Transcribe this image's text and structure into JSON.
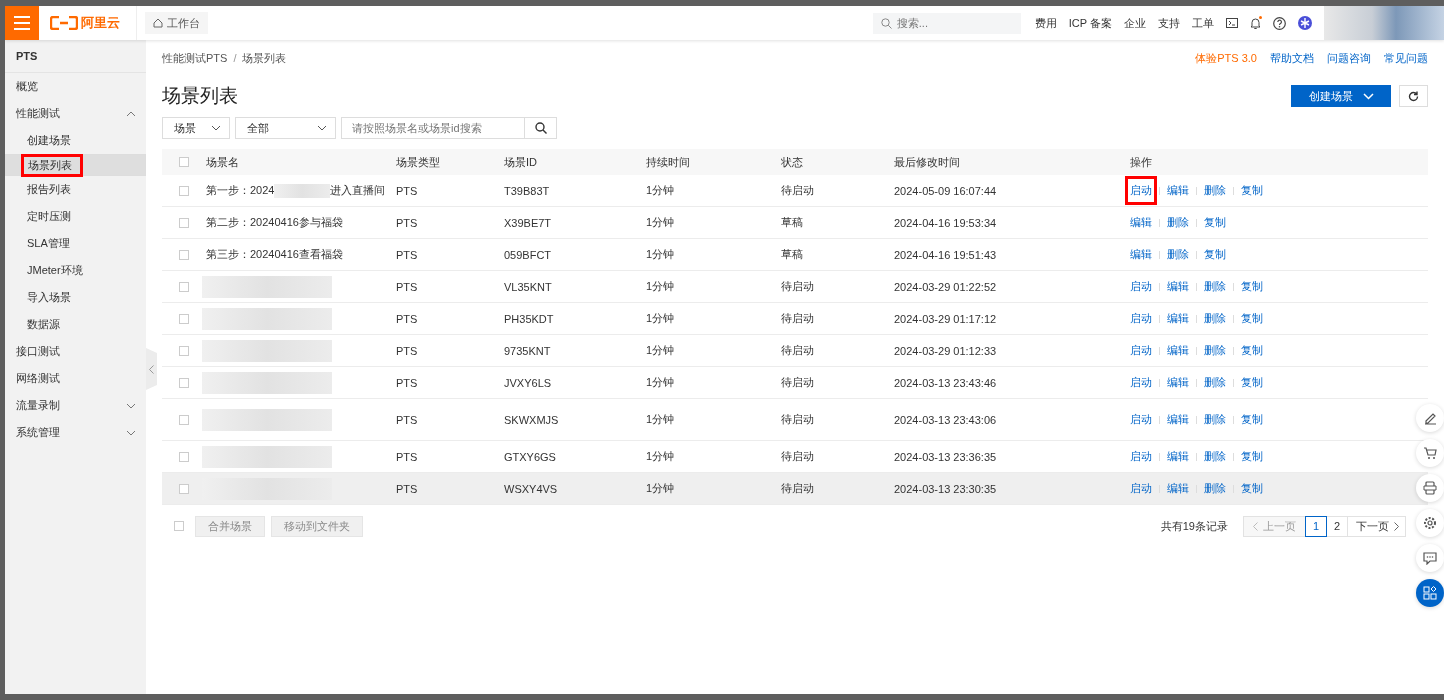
{
  "topbar": {
    "logo": "阿里云",
    "workbench": "工作台",
    "search": {
      "placeholder": "搜索..."
    },
    "links": [
      "费用",
      "ICP 备案",
      "企业",
      "支持",
      "工单"
    ],
    "bell_dot": true
  },
  "sidebar": {
    "title": "PTS",
    "items": [
      {
        "label": "概览",
        "selected": false,
        "highlighted": false
      },
      {
        "label": "性能测试",
        "selected": false,
        "highlighted": false,
        "expanded": true,
        "children": [
          {
            "label": "创建场景",
            "selected": false,
            "highlighted": false
          },
          {
            "label": "场景列表",
            "selected": true,
            "highlighted": true
          },
          {
            "label": "报告列表",
            "selected": false,
            "highlighted": false
          },
          {
            "label": "定时压测",
            "selected": false,
            "highlighted": false
          },
          {
            "label": "SLA管理",
            "selected": false,
            "highlighted": false
          },
          {
            "label": "JMeter环境",
            "selected": false,
            "highlighted": false
          },
          {
            "label": "导入场景",
            "selected": false,
            "highlighted": false
          },
          {
            "label": "数据源",
            "selected": false,
            "highlighted": false
          }
        ]
      },
      {
        "label": "接口测试",
        "selected": false,
        "highlighted": false
      },
      {
        "label": "网络测试",
        "selected": false,
        "highlighted": false
      },
      {
        "label": "流量录制",
        "selected": false,
        "highlighted": false,
        "expanded": false
      },
      {
        "label": "系统管理",
        "selected": false,
        "highlighted": false,
        "expanded": false
      }
    ]
  },
  "breadcrumb": [
    "性能测试PTS",
    "场景列表"
  ],
  "breadcrumb_separator": "/",
  "header_links": [
    {
      "label": "体验PTS 3.0",
      "kind": "promo"
    },
    {
      "label": "帮助文档",
      "kind": "link"
    },
    {
      "label": "问题咨询",
      "kind": "link"
    },
    {
      "label": "常见问题",
      "kind": "link"
    }
  ],
  "page_title": "场景列表",
  "create_button": "创建场景",
  "filters": {
    "type": "场景",
    "status": "全部",
    "search": {
      "placeholder": "请按照场景名或场景id搜索"
    }
  },
  "table": {
    "select_all": {
      "checked": false
    },
    "columns": [
      "场景名",
      "场景类型",
      "场景ID",
      "持续时间",
      "状态",
      "最后修改时间",
      "操作"
    ],
    "rows": [
      {
        "checked": false,
        "name": "第一步：2024",
        "name_after_blur": "进入直播间",
        "blurred": true,
        "tall": false,
        "type": "PTS",
        "id": "T39B83T",
        "duration": "1分钟",
        "status": "待启动",
        "modified": "2024-05-09 16:07:44",
        "hovered": false,
        "actions": [
          {
            "label": "启动",
            "highlighted": true
          },
          {
            "label": "编辑",
            "highlighted": false
          },
          {
            "label": "删除",
            "highlighted": false
          },
          {
            "label": "复制",
            "highlighted": false
          }
        ]
      },
      {
        "checked": false,
        "name": "第二步：20240416参与福袋",
        "blurred": false,
        "tall": false,
        "type": "PTS",
        "id": "X39BE7T",
        "duration": "1分钟",
        "status": "草稿",
        "modified": "2024-04-16 19:53:34",
        "hovered": false,
        "actions": [
          {
            "label": "编辑",
            "highlighted": false
          },
          {
            "label": "删除",
            "highlighted": false
          },
          {
            "label": "复制",
            "highlighted": false
          }
        ]
      },
      {
        "checked": false,
        "name": "第三步：20240416查看福袋",
        "blurred": false,
        "tall": false,
        "type": "PTS",
        "id": "059BFCT",
        "duration": "1分钟",
        "status": "草稿",
        "modified": "2024-04-16 19:51:43",
        "hovered": false,
        "actions": [
          {
            "label": "编辑",
            "highlighted": false
          },
          {
            "label": "删除",
            "highlighted": false
          },
          {
            "label": "复制",
            "highlighted": false
          }
        ]
      },
      {
        "checked": false,
        "blurred": true,
        "tall": false,
        "type": "PTS",
        "id": "VL35KNT",
        "duration": "1分钟",
        "status": "待启动",
        "modified": "2024-03-29 01:22:52",
        "hovered": false,
        "actions": [
          {
            "label": "启动",
            "highlighted": false
          },
          {
            "label": "编辑",
            "highlighted": false
          },
          {
            "label": "删除",
            "highlighted": false
          },
          {
            "label": "复制",
            "highlighted": false
          }
        ]
      },
      {
        "checked": false,
        "blurred": true,
        "tall": false,
        "type": "PTS",
        "id": "PH35KDT",
        "duration": "1分钟",
        "status": "待启动",
        "modified": "2024-03-29 01:17:12",
        "hovered": false,
        "actions": [
          {
            "label": "启动",
            "highlighted": false
          },
          {
            "label": "编辑",
            "highlighted": false
          },
          {
            "label": "删除",
            "highlighted": false
          },
          {
            "label": "复制",
            "highlighted": false
          }
        ]
      },
      {
        "checked": false,
        "blurred": true,
        "tall": false,
        "type": "PTS",
        "id": "9735KNT",
        "duration": "1分钟",
        "status": "待启动",
        "modified": "2024-03-29 01:12:33",
        "hovered": false,
        "actions": [
          {
            "label": "启动",
            "highlighted": false
          },
          {
            "label": "编辑",
            "highlighted": false
          },
          {
            "label": "删除",
            "highlighted": false
          },
          {
            "label": "复制",
            "highlighted": false
          }
        ]
      },
      {
        "checked": false,
        "blurred": true,
        "tall": false,
        "type": "PTS",
        "id": "JVXY6LS",
        "duration": "1分钟",
        "status": "待启动",
        "modified": "2024-03-13 23:43:46",
        "hovered": false,
        "actions": [
          {
            "label": "启动",
            "highlighted": false
          },
          {
            "label": "编辑",
            "highlighted": false
          },
          {
            "label": "删除",
            "highlighted": false
          },
          {
            "label": "复制",
            "highlighted": false
          }
        ]
      },
      {
        "checked": false,
        "blurred": true,
        "tall": true,
        "type": "PTS",
        "id": "SKWXMJS",
        "duration": "1分钟",
        "status": "待启动",
        "modified": "2024-03-13 23:43:06",
        "hovered": false,
        "actions": [
          {
            "label": "启动",
            "highlighted": false
          },
          {
            "label": "编辑",
            "highlighted": false
          },
          {
            "label": "删除",
            "highlighted": false
          },
          {
            "label": "复制",
            "highlighted": false
          }
        ]
      },
      {
        "checked": false,
        "blurred": true,
        "tall": false,
        "type": "PTS",
        "id": "GTXY6GS",
        "duration": "1分钟",
        "status": "待启动",
        "modified": "2024-03-13 23:36:35",
        "hovered": false,
        "actions": [
          {
            "label": "启动",
            "highlighted": false
          },
          {
            "label": "编辑",
            "highlighted": false
          },
          {
            "label": "删除",
            "highlighted": false
          },
          {
            "label": "复制",
            "highlighted": false
          }
        ]
      },
      {
        "checked": false,
        "blurred": true,
        "tall": false,
        "type": "PTS",
        "id": "WSXY4VS",
        "duration": "1分钟",
        "status": "待启动",
        "modified": "2024-03-13 23:30:35",
        "hovered": true,
        "actions": [
          {
            "label": "启动",
            "highlighted": false
          },
          {
            "label": "编辑",
            "highlighted": false
          },
          {
            "label": "删除",
            "highlighted": false
          },
          {
            "label": "复制",
            "highlighted": false
          }
        ]
      }
    ]
  },
  "footer_checkbox": {
    "checked": false
  },
  "bulk_actions": [
    "合并场景",
    "移动到文件夹"
  ],
  "total": "共有19条记录",
  "pagination": {
    "prev": "上一页",
    "next": "下一页",
    "pages": [
      {
        "label": "1",
        "selected": true
      },
      {
        "label": "2",
        "selected": false
      }
    ]
  }
}
